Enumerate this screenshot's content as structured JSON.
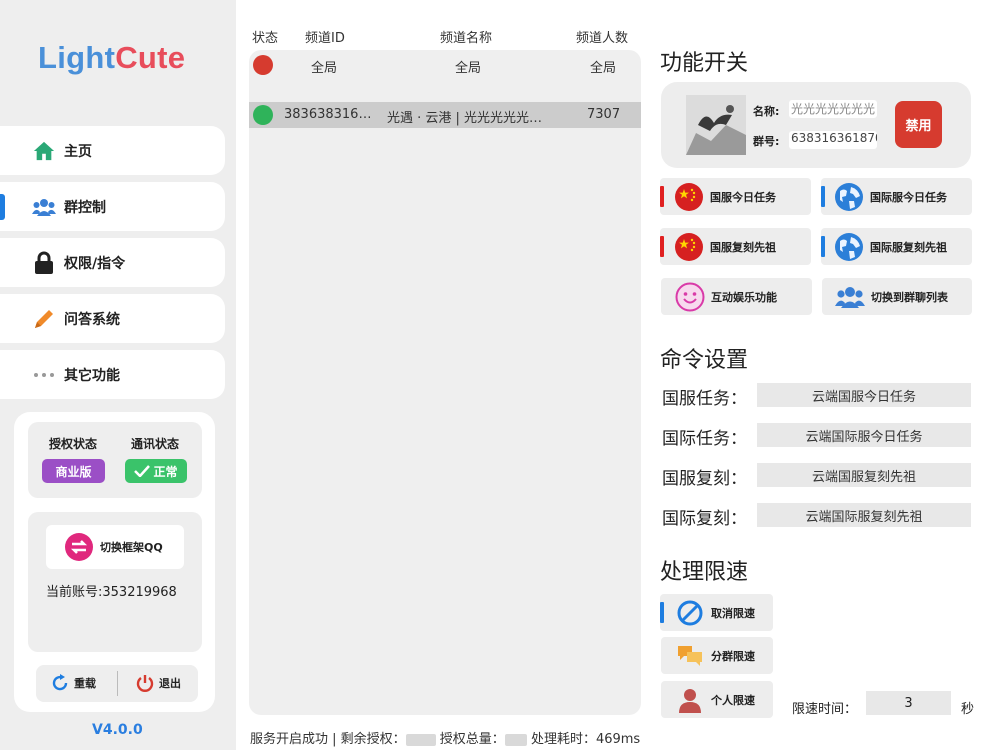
{
  "app": {
    "logo_a": "Light",
    "logo_b": "Cute",
    "version": "V4.0.0"
  },
  "nav": [
    {
      "label": "主页",
      "icon": "home-icon"
    },
    {
      "label": "群控制",
      "icon": "users-icon"
    },
    {
      "label": "权限/指令",
      "icon": "lock-icon"
    },
    {
      "label": "问答系统",
      "icon": "pencil-icon"
    },
    {
      "label": "其它功能",
      "icon": "more-dots-icon"
    }
  ],
  "status": {
    "auth_label": "授权状态",
    "comm_label": "通讯状态",
    "auth_value": "商业版",
    "comm_value": "正常"
  },
  "account": {
    "switch_label": "切换框架QQ",
    "current_label": "当前账号:",
    "current_value": "353219968"
  },
  "actions": {
    "reload": "重载",
    "exit": "退出"
  },
  "table": {
    "headers": [
      "状态",
      "频道ID",
      "频道名称",
      "频道人数"
    ],
    "rows": [
      {
        "status": "red",
        "id": "全局",
        "name": "全局",
        "count": "全局"
      },
      {
        "status": "green",
        "id": "383638316…",
        "name": "光遇 · 云港 | 光光光光光…",
        "count": "7307"
      }
    ]
  },
  "footer": {
    "text1": "服务开启成功 | 剩余授权：",
    "text2": "授权总量：",
    "text3": "处理耗时：469ms"
  },
  "features": {
    "title": "功能开关",
    "group": {
      "name_label": "名称:",
      "name_value": "光光光光光光光",
      "id_label": "群号:",
      "id_value": "638316361870",
      "disable_label": "禁用"
    },
    "buttons": [
      {
        "label": "国服今日任务",
        "icon": "china-flag-icon",
        "bar": "#e02020"
      },
      {
        "label": "国际服今日任务",
        "icon": "globe-icon",
        "bar": "#1e7de0"
      },
      {
        "label": "国服复刻先祖",
        "icon": "china-flag-icon",
        "bar": "#e02020"
      },
      {
        "label": "国际服复刻先祖",
        "icon": "globe-icon",
        "bar": "#1e7de0"
      },
      {
        "label": "互动娱乐功能",
        "icon": "smile-icon",
        "bar": ""
      },
      {
        "label": "切换到群聊列表",
        "icon": "group-icon",
        "bar": ""
      }
    ]
  },
  "commands": {
    "title": "命令设置",
    "items": [
      {
        "label": "国服任务：",
        "value": "云端国服今日任务"
      },
      {
        "label": "国际任务：",
        "value": "云端国际服今日任务"
      },
      {
        "label": "国服复刻：",
        "value": "云端国服复刻先祖"
      },
      {
        "label": "国际复刻：",
        "value": "云端国际服复刻先祖"
      }
    ]
  },
  "ratelimit": {
    "title": "处理限速",
    "buttons": [
      {
        "label": "取消限速",
        "icon": "ban-icon"
      },
      {
        "label": "分群限速",
        "icon": "chat-bubbles-icon"
      },
      {
        "label": "个人限速",
        "icon": "person-icon"
      }
    ],
    "time_label": "限速时间：",
    "time_value": "3",
    "time_unit": "秒"
  },
  "colors": {
    "accent": "#1e7de0",
    "danger": "#d63b2f",
    "success": "#2fb35a",
    "badge_purple": "#9b4fc6",
    "badge_green": "#3ac36a"
  }
}
